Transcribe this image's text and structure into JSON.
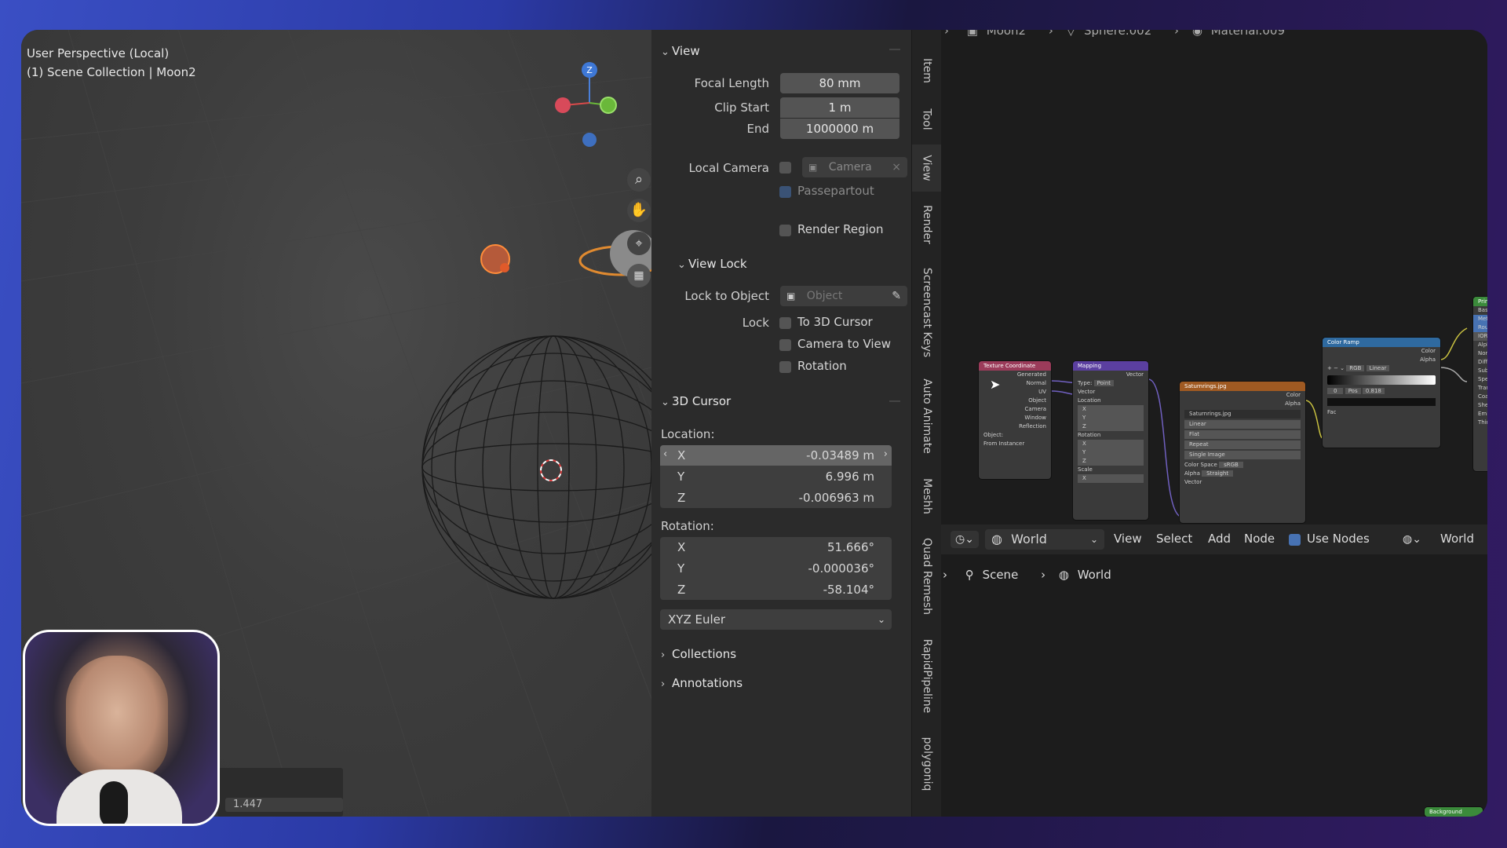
{
  "viewport": {
    "line1": "User Perspective (Local)",
    "line2": "(1) Scene Collection | Moon2",
    "gizmo_z": "Z",
    "bottom_value": "1.447"
  },
  "npanel": {
    "view_section": "View",
    "focal_length_label": "Focal Length",
    "focal_length_value": "80 mm",
    "clip_start_label": "Clip Start",
    "clip_start_value": "1 m",
    "clip_end_label": "End",
    "clip_end_value": "1000000 m",
    "local_camera_label": "Local Camera",
    "local_camera_placeholder": "Camera",
    "passepartout_label": "Passepartout",
    "render_region_label": "Render Region",
    "view_lock_section": "View Lock",
    "lock_to_object_label": "Lock to Object",
    "lock_to_object_placeholder": "Object",
    "lock_label": "Lock",
    "lock_options": [
      "To 3D Cursor",
      "Camera to View",
      "Rotation"
    ],
    "cursor_section": "3D Cursor",
    "location_label": "Location:",
    "location": [
      {
        "axis": "X",
        "value": "-0.03489 m"
      },
      {
        "axis": "Y",
        "value": "6.996 m"
      },
      {
        "axis": "Z",
        "value": "-0.006963 m"
      }
    ],
    "rotation_label": "Rotation:",
    "rotation": [
      {
        "axis": "X",
        "value": "51.666°"
      },
      {
        "axis": "Y",
        "value": "-0.000036°"
      },
      {
        "axis": "Z",
        "value": "-58.104°"
      }
    ],
    "rotation_mode": "XYZ Euler",
    "collections_section": "Collections",
    "annotations_section": "Annotations"
  },
  "sidebar_tabs": [
    "Item",
    "Tool",
    "View",
    "Render",
    "Screencast Keys",
    "Auto Animate",
    "Meshh",
    "Quad Remesh",
    "RapidPipeline",
    "polygoniq"
  ],
  "node_editor": {
    "breadcrumb_top": [
      "Moon2",
      "Sphere.002",
      "Material.009"
    ],
    "header": {
      "world_dropdown": "World",
      "menus": [
        "View",
        "Select",
        "Add",
        "Node"
      ],
      "use_nodes_label": "Use Nodes",
      "world_right": "World"
    },
    "breadcrumb": [
      "Scene",
      "World"
    ],
    "nodes": {
      "texcoord_title": "Texture Coordinate",
      "texcoord_outputs": [
        "Generated",
        "Normal",
        "UV",
        "Object",
        "Camera",
        "Window",
        "Reflection"
      ],
      "texcoord_object_label": "Object:",
      "texcoord_from_instancer": "From Instancer",
      "mapping_title": "Mapping",
      "mapping_rows": [
        "Vector",
        "Type:",
        "Point",
        "Vector",
        "Location",
        "X",
        "Y",
        "Z",
        "Rotation",
        "X",
        "Y",
        "Z",
        "Scale",
        "X"
      ],
      "image_title": "Saturnrings.jpg",
      "image_rows": [
        "Color",
        "Alpha",
        "Saturnrings.jpg",
        "Linear",
        "Flat",
        "Repeat",
        "Single Image",
        "Color Space",
        "sRGB",
        "Alpha",
        "Straight",
        "Vector"
      ],
      "ramp_title": "Color Ramp",
      "ramp_rows": [
        "Color",
        "Alpha",
        "RGB",
        "Linear",
        "0",
        "Pos",
        "0.818",
        "Fac"
      ],
      "principled_title": "Principled",
      "principled_rows": [
        "Base Color",
        "Metallic",
        "Roughness",
        "IOR",
        "Alpha",
        "Normal",
        "Diffuse",
        "Subsurface",
        "Specular",
        "Transmission",
        "Coat",
        "Sheen",
        "Emission",
        "Thin Film"
      ],
      "background_title": "Background"
    }
  },
  "colors": {
    "accent_blue": "#4772b3",
    "texcoord_header": "#9b3b5a",
    "mapping_header": "#5b3fa0",
    "image_header": "#a05a22",
    "ramp_header": "#2f6aa0",
    "principled_header": "#3b8a3b"
  }
}
